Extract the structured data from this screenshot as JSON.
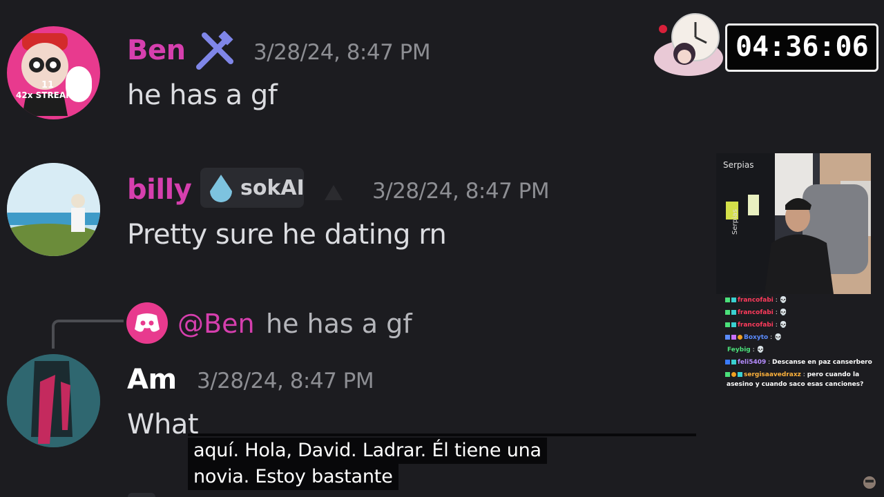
{
  "messages": [
    {
      "author": "Ben",
      "timestamp": "3/28/24, 8:47 PM",
      "text": "he has a gf",
      "streak": "42x STREAK",
      "jersey": "11"
    },
    {
      "author": "billy",
      "tag": "sokAI",
      "timestamp": "3/28/24, 8:47 PM",
      "text": "Pretty sure he dating rn"
    },
    {
      "reply_mention": "@Ben",
      "reply_text": "he has a gf",
      "author": "Am",
      "timestamp": "3/28/24, 8:47 PM",
      "text": "What"
    }
  ],
  "timer": "04:36:06",
  "webcam": {
    "poster_text": "Serpias",
    "stand_text": "Serpias"
  },
  "chat": [
    {
      "user": "francofabi",
      "sep": ":",
      "text": "💀",
      "color": "#ff3b5c"
    },
    {
      "user": "francofabi",
      "sep": ":",
      "text": "💀",
      "color": "#ff3b5c"
    },
    {
      "user": "francofabi",
      "sep": ":",
      "text": "💀",
      "color": "#ff3b5c"
    },
    {
      "user": "Boxyto",
      "sep": ":",
      "text": "💀",
      "color": "#5b8cff"
    },
    {
      "user": "Feybig",
      "sep": ":",
      "text": "💀",
      "color": "#4be07a"
    },
    {
      "user": "feli5409",
      "sep": ":",
      "text": "Descanse en paz canserbero",
      "color": "#b58cff"
    },
    {
      "user": "sergisaavedraxz",
      "sep": ":",
      "text": "pero cuando la",
      "text2": "asesino y cuando saco esas canciones?",
      "color": "#ffb23b"
    }
  ],
  "subtitles": {
    "line1": "aquí.  Hola, David.  Ladrar.  Él tiene una",
    "line2": "novia.  Estoy bastante"
  },
  "colors": {
    "bg": "#1c1c20",
    "ben": "#d63fae",
    "billy": "#d63fae",
    "am": "#ffffff",
    "timestamp": "#8d8e93"
  }
}
